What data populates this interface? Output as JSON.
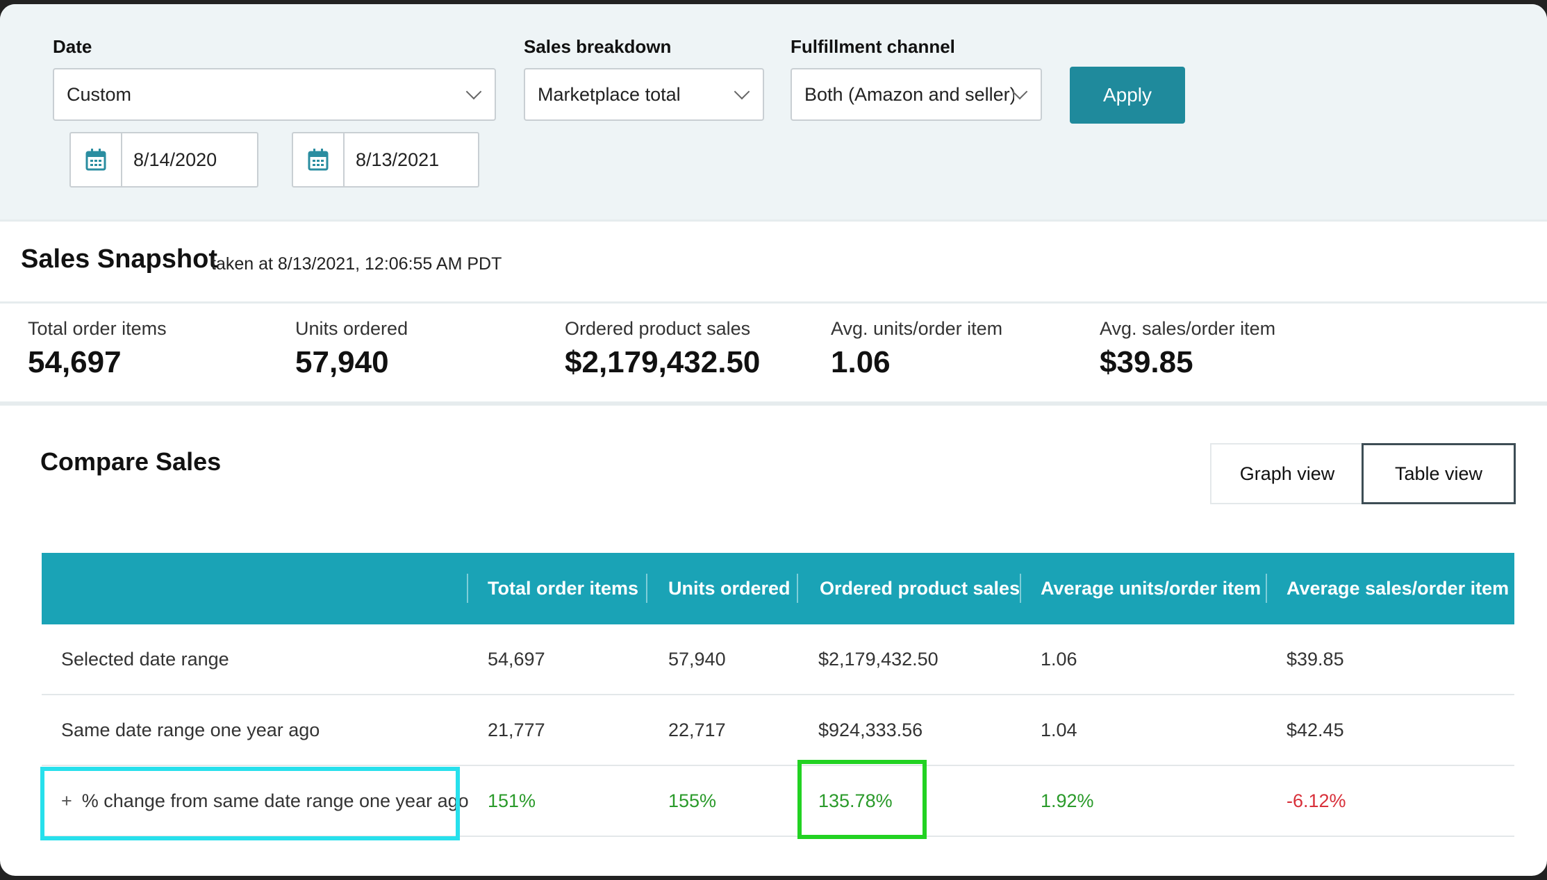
{
  "filters": {
    "date_label": "Date",
    "date_value": "Custom",
    "start_date": "8/14/2020",
    "end_date": "8/13/2021",
    "breakdown_label": "Sales breakdown",
    "breakdown_value": "Marketplace total",
    "channel_label": "Fulfillment channel",
    "channel_value": "Both (Amazon and seller)",
    "apply_label": "Apply"
  },
  "snapshot": {
    "title": "Sales Snapshot",
    "subtitle": "taken at 8/13/2021, 12:06:55 AM PDT",
    "metrics": [
      {
        "label": "Total order items",
        "value": "54,697"
      },
      {
        "label": "Units ordered",
        "value": "57,940"
      },
      {
        "label": "Ordered product sales",
        "value": "$2,179,432.50"
      },
      {
        "label": "Avg. units/order item",
        "value": "1.06"
      },
      {
        "label": "Avg. sales/order item",
        "value": "$39.85"
      }
    ]
  },
  "compare": {
    "title": "Compare Sales",
    "graph_view": "Graph view",
    "table_view": "Table view",
    "columns": [
      "Total order items",
      "Units ordered",
      "Ordered product sales",
      "Average units/order item",
      "Average sales/order item"
    ],
    "rows": [
      {
        "label": "Selected date range",
        "cells": [
          "54,697",
          "57,940",
          "$2,179,432.50",
          "1.06",
          "$39.85"
        ]
      },
      {
        "label": "Same date range one year ago",
        "cells": [
          "21,777",
          "22,717",
          "$924,333.56",
          "1.04",
          "$42.45"
        ]
      },
      {
        "label": "% change from same date range one year ago",
        "expand": "+",
        "cells": [
          "151%",
          "155%",
          "135.78%",
          "1.92%",
          "-6.12%"
        ]
      }
    ]
  },
  "colors": {
    "accent": "#1aa3b6",
    "positive": "#2a9a2a",
    "negative": "#d8303a",
    "highlight_cyan": "#27e0ec",
    "highlight_green": "#22d222"
  }
}
